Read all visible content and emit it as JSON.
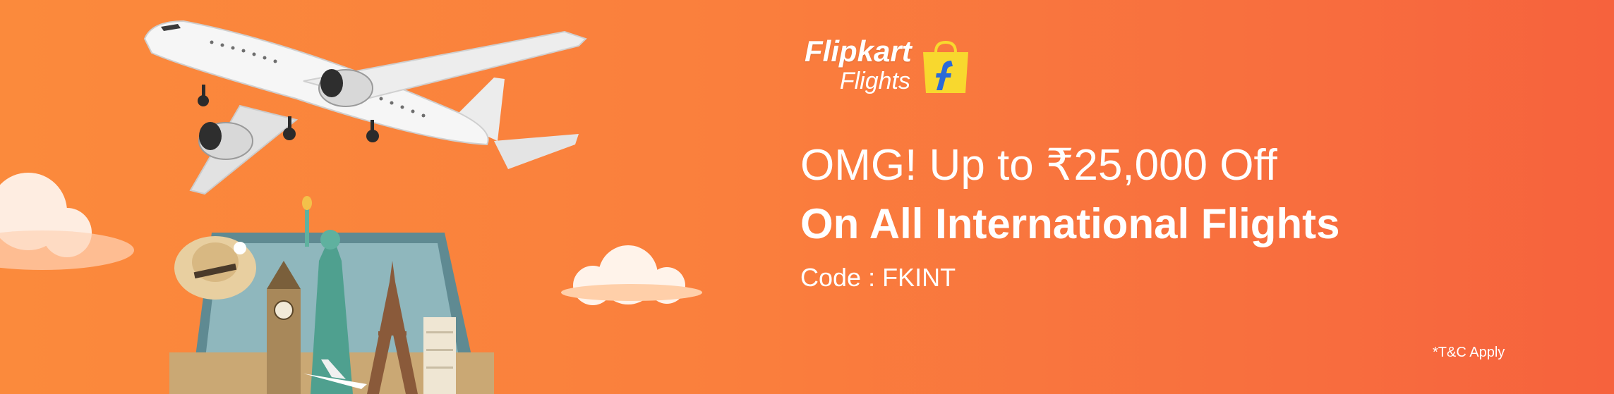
{
  "banner": {
    "logo": {
      "brand": "Flipkart",
      "product": "Flights"
    },
    "headline": "OMG! Up to ₹25,000 Off",
    "subheadline": "On All International Flights",
    "code_text": "Code : FKINT",
    "terms": "*T&C Apply"
  },
  "colors": {
    "background_start": "#fb8a3c",
    "background_end": "#f6623d",
    "bag_yellow": "#f8d82e",
    "flipkart_blue": "#2a6ad8",
    "text": "#ffffff"
  },
  "icons": [
    "airplane-icon",
    "flipkart-bag-icon",
    "cloud-icon",
    "statue-of-liberty-icon",
    "big-ben-icon",
    "eiffel-tower-icon",
    "suitcase-icon",
    "hat-icon"
  ]
}
